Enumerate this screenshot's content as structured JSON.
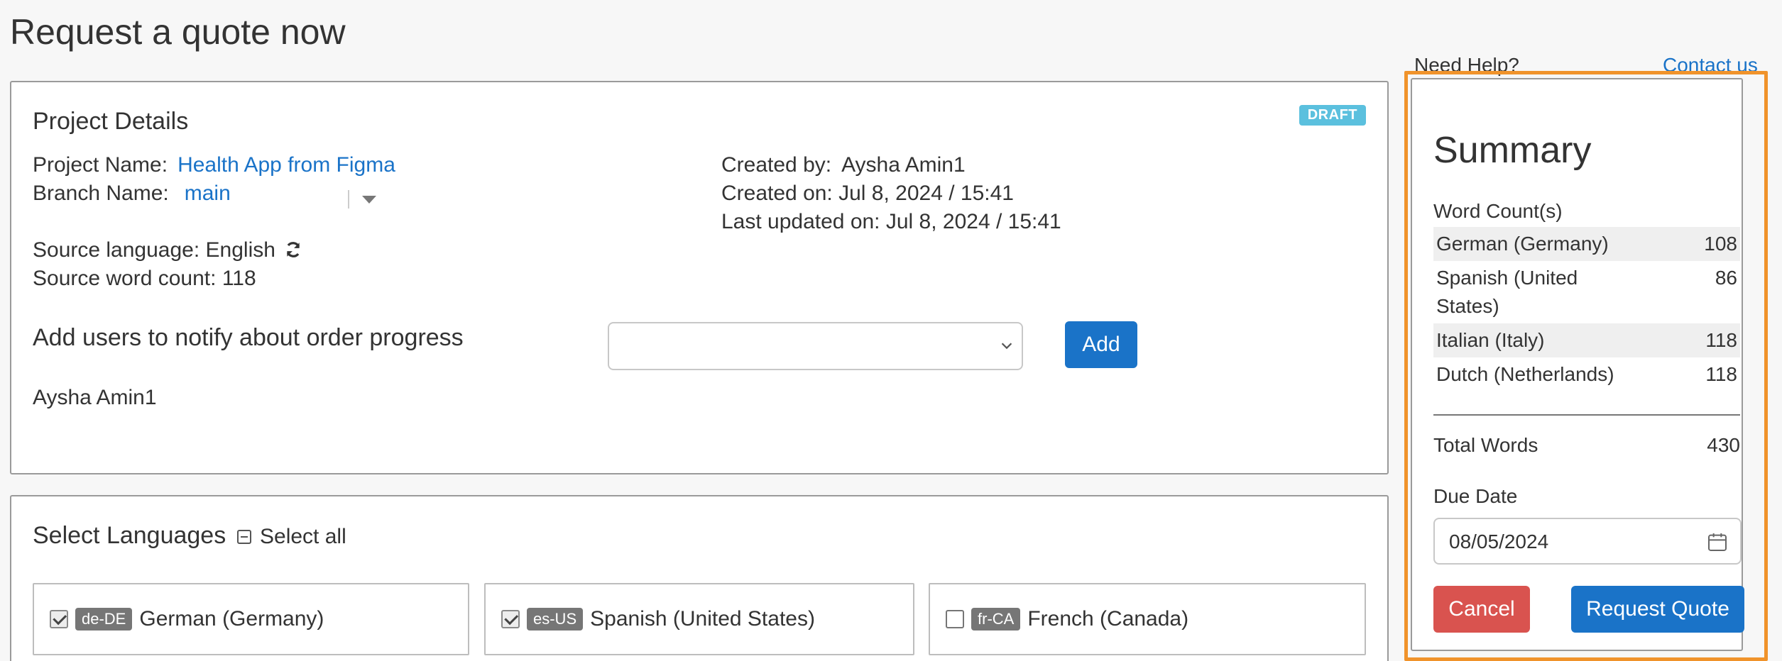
{
  "page": {
    "title": "Request a quote now"
  },
  "help": {
    "question": "Need Help?",
    "contact": "Contact us"
  },
  "project": {
    "title": "Project Details",
    "status_badge": "DRAFT",
    "project_name_label": "Project Name:",
    "project_name": "Health App from Figma",
    "branch_label": "Branch Name:",
    "branch": "main",
    "source_language_label": "Source language:",
    "source_language": "English",
    "source_word_count_label": "Source word count:",
    "source_word_count": "118",
    "created_by_label": "Created by:",
    "created_by": "Aysha Amin1",
    "created_on_label": "Created on:",
    "created_on": "Jul 8, 2024 / 15:41",
    "last_updated_label": "Last updated on:",
    "last_updated": "Jul 8, 2024 / 15:41"
  },
  "notify": {
    "title": "Add users to notify about order progress",
    "select_value": "",
    "add_label": "Add",
    "users": [
      "Aysha Amin1"
    ]
  },
  "languages": {
    "title": "Select Languages",
    "select_all_label": "Select all",
    "items": [
      {
        "code": "de-DE",
        "name": "German (Germany)",
        "checked": true
      },
      {
        "code": "es-US",
        "name": "Spanish (United States)",
        "checked": true
      },
      {
        "code": "fr-CA",
        "name": "French (Canada)",
        "checked": false
      }
    ]
  },
  "summary": {
    "title": "Summary",
    "word_counts_label": "Word Count(s)",
    "word_counts": [
      {
        "language": "German (Germany)",
        "count": "108"
      },
      {
        "language": "Spanish (United States)",
        "count": "86"
      },
      {
        "language": "Italian (Italy)",
        "count": "118"
      },
      {
        "language": "Dutch (Netherlands)",
        "count": "118"
      }
    ],
    "total_label": "Total Words",
    "total": "430",
    "due_date_label": "Due Date",
    "due_date": "08/05/2024",
    "cancel_label": "Cancel",
    "request_label": "Request Quote"
  },
  "colors": {
    "primary": "#1a73c8",
    "danger": "#d9534f",
    "highlight": "#f0932b",
    "draft_badge": "#5bc0de"
  }
}
